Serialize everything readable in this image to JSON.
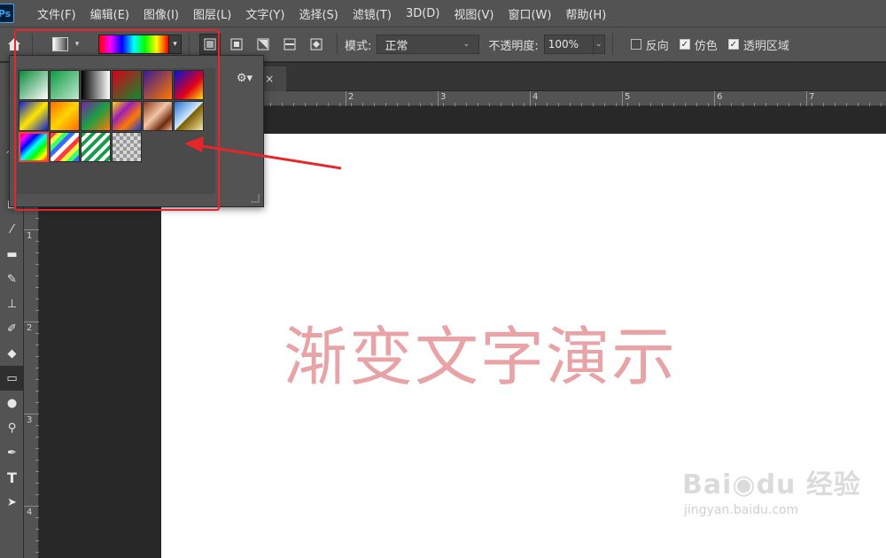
{
  "app": {
    "logo": "Ps"
  },
  "menu": [
    "文件(F)",
    "编辑(E)",
    "图像(I)",
    "图层(L)",
    "文字(Y)",
    "选择(S)",
    "滤镜(T)",
    "3D(D)",
    "视图(V)",
    "窗口(W)",
    "帮助(H)"
  ],
  "options": {
    "mode_label": "模式:",
    "mode_value": "正常",
    "opacity_label": "不透明度:",
    "opacity_value": "100%",
    "reverse_label": "反向",
    "dither_label": "仿色",
    "transparency_label": "透明区域",
    "reverse_checked": false,
    "dither_checked": true,
    "transparency_checked": true
  },
  "ruler": {
    "h_numbers": [
      "2",
      "3",
      "4",
      "5",
      "6",
      "7"
    ],
    "v_numbers": [
      "1",
      "2",
      "3",
      "4"
    ]
  },
  "document": {
    "close_label": "×",
    "canvas_text": "渐变文字演示",
    "canvas_text_color": "#e7a3a6"
  },
  "gradient_presets": [
    {
      "name": "green-white",
      "css": "linear-gradient(135deg,#0a8a3a,#fff)"
    },
    {
      "name": "green-transparent",
      "css": "linear-gradient(135deg,#0e9a44,#bfe8cc)"
    },
    {
      "name": "black-white",
      "css": "linear-gradient(90deg,#000,#fff)"
    },
    {
      "name": "red-green",
      "css": "linear-gradient(135deg,#d8001a,#0f8b2e)"
    },
    {
      "name": "violet-orange",
      "css": "linear-gradient(135deg,#3b1a92,#ff7a00)"
    },
    {
      "name": "blue-red-yellow",
      "css": "linear-gradient(135deg,#0013d4,#e3001b 60%,#ffe100)"
    },
    {
      "name": "blue-yellow-blue",
      "css": "linear-gradient(135deg,#0a1ed8,#ffe600 50%,#0a1ed8)"
    },
    {
      "name": "orange-yellow-orange",
      "css": "linear-gradient(135deg,#ff6a00,#ffd400 50%,#ff6a00)"
    },
    {
      "name": "violet-green-orange",
      "css": "linear-gradient(135deg,#7a1fa8,#1c9e45 50%,#ff7a00)"
    },
    {
      "name": "yellow-violet-orange-blue",
      "css": "linear-gradient(135deg,#ffd900,#9b1fb5 35%,#ff7a00 65%,#1c3bd8)"
    },
    {
      "name": "copper",
      "css": "linear-gradient(135deg,#8b3a1a,#f3c5a7 45%,#6e2a10 75%,#f0b48e)"
    },
    {
      "name": "chrome",
      "css": "linear-gradient(135deg,#2a6fd0,#d2ecff 50%,#7a5a00 52%,#f5e7a0)"
    },
    {
      "name": "spectrum",
      "css": "linear-gradient(135deg,#ff0000,#ff00ff 16%,#0000ff 33%,#00ffff 50%,#00ff00 66%,#ffff00 83%,#ff0000)"
    },
    {
      "name": "transparent-rainbow",
      "css": "repeating-linear-gradient(135deg,#ff3b3b 0 5px,#ffef3b 5px 10px,#3bff6a 10px 15px,#3b6aff 15px 20px,#ffffff 20px 25px)"
    },
    {
      "name": "transparent-stripes",
      "css": "repeating-linear-gradient(135deg,#1a9b4a 0 4px,#ffffff 4px 8px)"
    },
    {
      "name": "neutral-density",
      "css": "repeating-conic-gradient(#9a9a9a 0 25%,#d8d8d8 0 50%) 0 0/8px 8px"
    }
  ],
  "watermark": {
    "line1": "Bai◉du 经验",
    "line2": "jingyan.baidu.com"
  }
}
